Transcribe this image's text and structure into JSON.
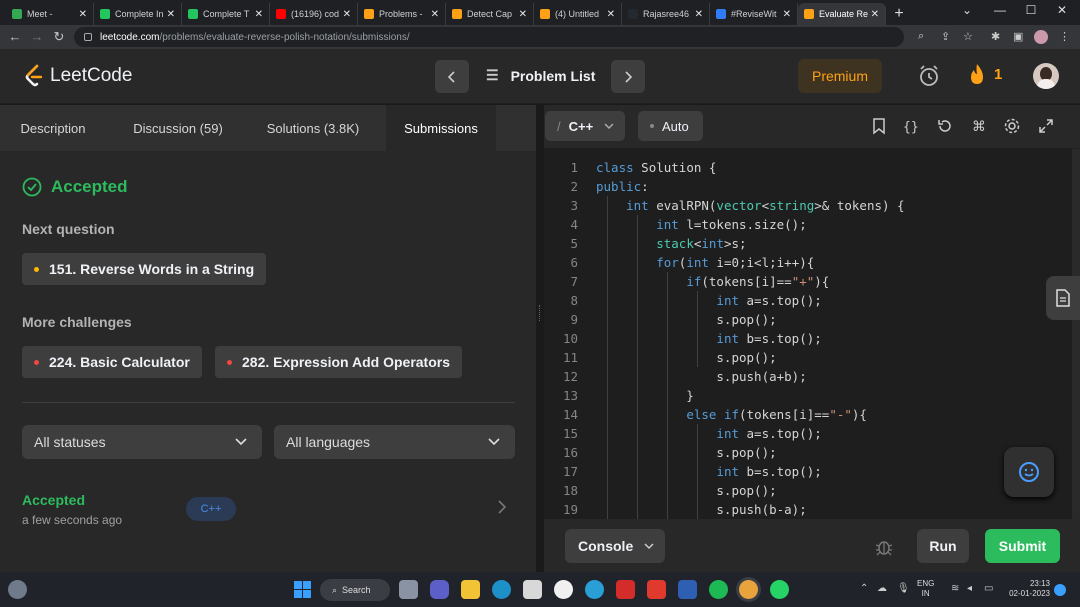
{
  "browser": {
    "tabs": [
      {
        "title": "Meet -",
        "color": "#34a853"
      },
      {
        "title": "Complete In",
        "color": "#23c55e"
      },
      {
        "title": "Complete T",
        "color": "#23c55e"
      },
      {
        "title": "(16196) cod",
        "color": "#ff0000"
      },
      {
        "title": "Problems -",
        "color": "#ffa116"
      },
      {
        "title": "Detect Cap",
        "color": "#ffa116"
      },
      {
        "title": "(4) Untitled",
        "color": "#ffa116"
      },
      {
        "title": "Rajasree46",
        "color": "#24292f"
      },
      {
        "title": "#ReviseWit",
        "color": "#2f7cf6"
      },
      {
        "title": "Evaluate Re",
        "color": "#ffa116"
      }
    ],
    "url_domain": "leetcode.com",
    "url_path": "/problems/evaluate-reverse-polish-notation/submissions/"
  },
  "header": {
    "logo_text": "LeetCode",
    "problem_list_label": "Problem List",
    "premium_label": "Premium",
    "streak_count": "1"
  },
  "left": {
    "tabs": [
      "Description",
      "Discussion (59)",
      "Solutions (3.8K)",
      "Submissions"
    ],
    "status_title": "Accepted",
    "next_question_label": "Next question",
    "next_question": "151. Reverse Words in a String",
    "more_challenges_label": "More challenges",
    "challenges": [
      "224. Basic Calculator",
      "282. Expression Add Operators"
    ],
    "filter_status": "All statuses",
    "filter_language": "All languages",
    "submission": {
      "status": "Accepted",
      "time": "a few seconds ago",
      "language": "C++"
    }
  },
  "editor": {
    "language": "C++",
    "mode": "Auto",
    "lines": [
      "class Solution {",
      "public:",
      "    int evalRPN(vector<string>& tokens) {",
      "        int l=tokens.size();",
      "        stack<int>s;",
      "        for(int i=0;i<l;i++){",
      "            if(tokens[i]==\"+\"){",
      "                int a=s.top();",
      "                s.pop();",
      "                int b=s.top();",
      "                s.pop();",
      "                s.push(a+b);",
      "            }",
      "            else if(tokens[i]==\"-\"){",
      "                int a=s.top();",
      "                s.pop();",
      "                int b=s.top();",
      "                s.pop();",
      "                s.push(b-a);"
    ],
    "console_label": "Console",
    "run_label": "Run",
    "submit_label": "Submit"
  },
  "taskbar": {
    "search_label": "Search",
    "lang_top": "ENG",
    "lang_bottom": "IN",
    "time": "23:13",
    "date": "02-01-2023"
  }
}
